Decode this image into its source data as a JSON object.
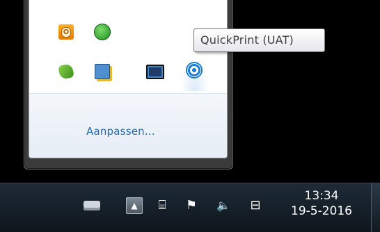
{
  "tooltip": {
    "text": "QuickPrint (UAT)"
  },
  "overflow_panel": {
    "customize_label": "Aanpassen...",
    "icons": [
      {
        "name": "outlook-icon",
        "glyph": "O"
      },
      {
        "name": "sync-icon"
      },
      {
        "name": "green-app-icon"
      },
      {
        "name": "card-app-icon"
      },
      {
        "name": "monitor-app-icon"
      },
      {
        "name": "quickprint-icon"
      }
    ]
  },
  "taskbar": {
    "show_hidden_glyph": "▲",
    "clock_time": "13:34",
    "clock_date": "19-5-2016",
    "tray_icons": [
      "keyboard-icon",
      "show-hidden-icons-button",
      "power-plug-icon",
      "action-center-flag-icon",
      "volume-icon",
      "network-icon"
    ],
    "glyphs": {
      "power": "⌸",
      "flag": "⚑",
      "volume": "🔈",
      "network": "⊟"
    }
  },
  "colors": {
    "link": "#2468b3",
    "quickprint_blue": "#1a7ed6",
    "taskbar": "#0f161d"
  }
}
